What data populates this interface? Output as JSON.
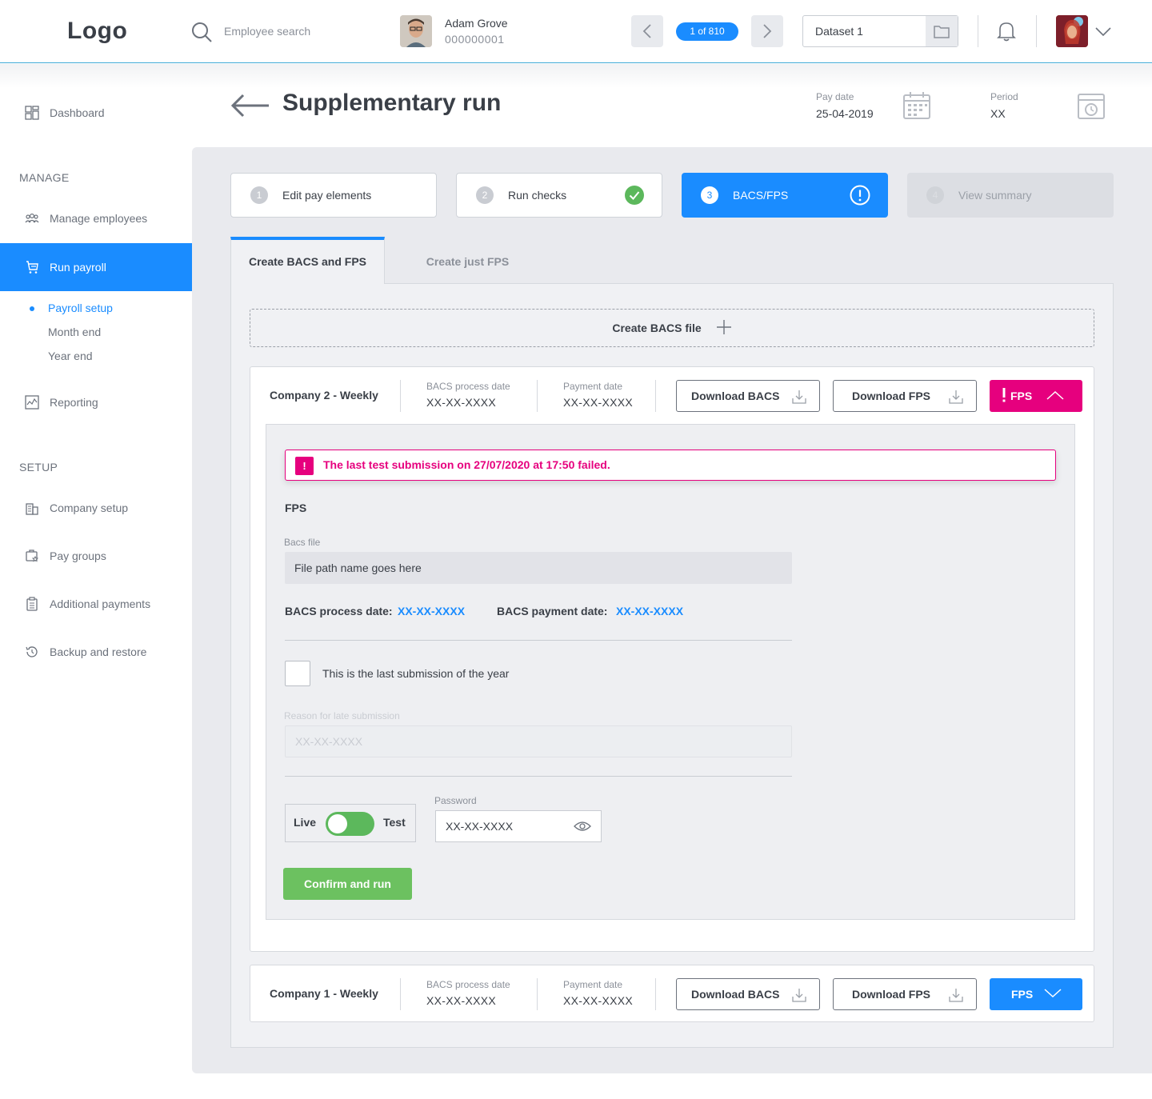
{
  "header": {
    "logo": "Logo",
    "search_placeholder": "Employee search",
    "employee": {
      "name": "Adam Grove",
      "id": "000000001"
    },
    "counter": "1 of 810",
    "dataset": "Dataset 1"
  },
  "sidebar": {
    "dashboard": "Dashboard",
    "manage_heading": "MANAGE",
    "manage_employees": "Manage employees",
    "run_payroll": "Run payroll",
    "sub_items": [
      "Payroll setup",
      "Month end",
      "Year end"
    ],
    "reporting": "Reporting",
    "setup_heading": "SETUP",
    "company_setup": "Company setup",
    "pay_groups": "Pay groups",
    "additional_payments": "Additional payments",
    "backup_restore": "Backup and restore"
  },
  "page": {
    "title": "Supplementary run",
    "pay_date_label": "Pay date",
    "pay_date": "25-04-2019",
    "period_label": "Period",
    "period": "XX"
  },
  "steps": [
    {
      "num": "1",
      "label": "Edit pay elements",
      "state": "default"
    },
    {
      "num": "2",
      "label": "Run checks",
      "state": "complete"
    },
    {
      "num": "3",
      "label": "BACS/FPS",
      "state": "active-warning"
    },
    {
      "num": "4",
      "label": "View summary",
      "state": "disabled"
    }
  ],
  "tabs": {
    "active": "Create BACS and FPS",
    "inactive": "Create just FPS"
  },
  "create_bacs": "Create BACS file",
  "companies": [
    {
      "name": "Company 2 - Weekly",
      "bacs_label": "BACS process date",
      "bacs_value": "XX-XX-XXXX",
      "payment_label": "Payment date",
      "payment_value": "XX-XX-XXXX",
      "download_bacs": "Download BACS",
      "download_fps": "Download FPS",
      "fps_button": "FPS",
      "fps_color": "#e6007e"
    },
    {
      "name": "Company 1 - Weekly",
      "bacs_label": "BACS process date",
      "bacs_value": "XX-XX-XXXX",
      "payment_label": "Payment date",
      "payment_value": "XX-XX-XXXX",
      "download_bacs": "Download BACS",
      "download_fps": "Download FPS",
      "fps_button": "FPS",
      "fps_color": "#1a8cff"
    }
  ],
  "fps_panel": {
    "alert": "The last test submission on 27/07/2020 at 17:50 failed.",
    "alert_icon": "!",
    "title": "FPS",
    "bacs_file_label": "Bacs file",
    "bacs_file_value": "File path name goes here",
    "process_date_label": "BACS process date:",
    "process_date_value": "XX-XX-XXXX",
    "payment_date_label": "BACS payment date:",
    "payment_date_value": "XX-XX-XXXX",
    "last_submission_label": "This is the last submission of the year",
    "last_submission_checked": false,
    "reason_label": "Reason for late submission",
    "reason_placeholder": "XX-XX-XXXX",
    "toggle_live": "Live",
    "toggle_test": "Test",
    "password_label": "Password",
    "password_value": "XX-XX-XXXX",
    "confirm": "Confirm and run"
  },
  "colors": {
    "accent": "#1a8cff",
    "error": "#e6007e",
    "success": "#6cc160"
  }
}
